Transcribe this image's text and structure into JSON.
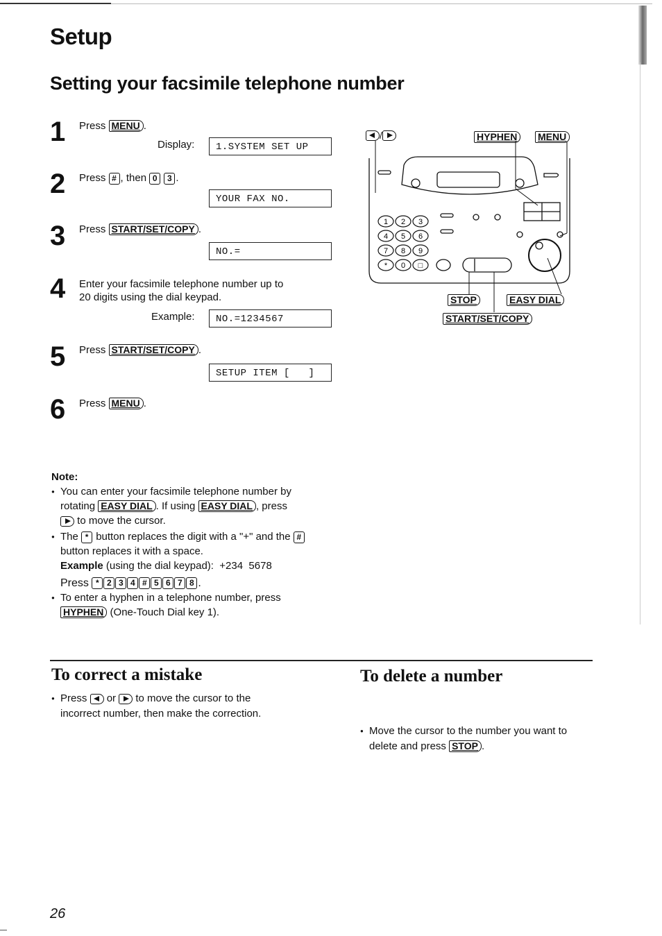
{
  "section_title": "Setup",
  "page_heading": "Setting your facsimile telephone number",
  "steps": [
    {
      "num": "1",
      "pre": "Press",
      "key": "MENU",
      "post": ".",
      "display_label": "Display:",
      "display": "1.SYSTEM SET UP"
    },
    {
      "num": "2",
      "pre": "Press",
      "key1": "#",
      "mid": ", then",
      "key2": "0",
      "key3": "3",
      "post": ".",
      "display": "YOUR FAX NO."
    },
    {
      "num": "3",
      "pre": "Press",
      "key": "START/SET/COPY",
      "post": ".",
      "display": "NO.="
    },
    {
      "num": "4",
      "line1": "Enter your facsimile telephone number up to",
      "line2": "20 digits using the dial keypad.",
      "display_label": "Example:",
      "display": "NO.=1234567"
    },
    {
      "num": "5",
      "pre": "Press",
      "key": "START/SET/COPY",
      "post": ".",
      "display": "SETUP ITEM [   ]"
    },
    {
      "num": "6",
      "pre": "Press",
      "key": "MENU",
      "post": "."
    }
  ],
  "diagram": {
    "labels": {
      "arrows": "◀/▶",
      "hyphen": "HYPHEN",
      "menu": "MENU",
      "stop": "STOP",
      "easy_dial": "EASY DIAL",
      "start_set_copy": "START/SET/COPY"
    },
    "keypad": [
      "1",
      "2",
      "3",
      "4",
      "5",
      "6",
      "7",
      "8",
      "9",
      "*",
      "0",
      "#"
    ]
  },
  "note": {
    "title": "Note:",
    "b1_a": "You can enter your facsimile telephone number by",
    "b1_b": "rotating",
    "b1_key1": "EASY DIAL",
    "b1_c": ". If using",
    "b1_key2": "EASY DIAL",
    "b1_d": ", press",
    "b1_e": "to move the cursor.",
    "b2_a": "The",
    "b2_star": "*",
    "b2_b": "button replaces the digit with a \"+\" and the",
    "b2_hash": "#",
    "b2_c": "button replaces it with a space.",
    "example_bold": "Example",
    "example_rest": "(using the dial keypad):  +234  5678",
    "press": "Press",
    "press_keys": [
      "*",
      "2",
      "3",
      "4",
      "#",
      "5",
      "6",
      "7",
      "8"
    ],
    "press_end": ".",
    "b3_a": "To enter a hyphen in a telephone number, press",
    "b3_key": "HYPHEN",
    "b3_b": "(One-Touch Dial key 1)."
  },
  "correct": {
    "title": "To correct a mistake",
    "a": "Press",
    "b": "or",
    "c": "to move the cursor to the",
    "d": "incorrect number, then make the correction."
  },
  "delete": {
    "title": "To delete a number",
    "a": "Move the cursor to the number you want to",
    "b": "delete and press",
    "key": "STOP",
    "c": "."
  },
  "page_number": "26"
}
